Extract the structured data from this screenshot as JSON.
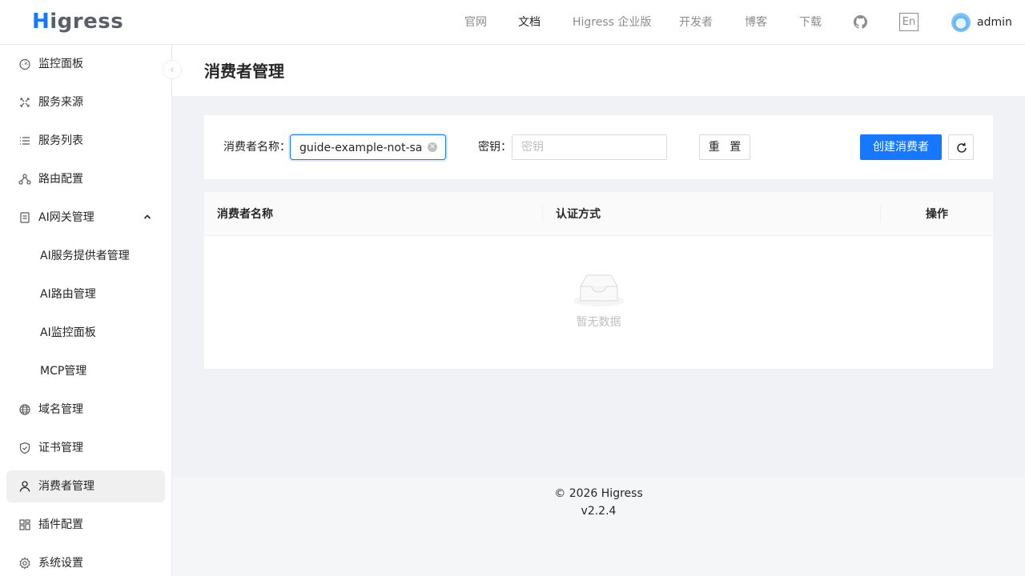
{
  "header": {
    "logo": "Higress",
    "nav": [
      "官网",
      "文档",
      "Higress 企业版",
      "开发者",
      "博客",
      "下载"
    ],
    "active_nav": "文档",
    "lang_button": "En",
    "github_icon": "github-icon",
    "username": "admin"
  },
  "sidebar": {
    "collapse_icon": "chevron-left-icon",
    "items": [
      {
        "label": "监控面板",
        "icon": "dashboard-icon"
      },
      {
        "label": "服务来源",
        "icon": "source-icon"
      },
      {
        "label": "服务列表",
        "icon": "list-icon"
      },
      {
        "label": "路由配置",
        "icon": "route-icon"
      },
      {
        "label": "AI网关管理",
        "icon": "ai-gateway-icon",
        "expanded": true
      },
      {
        "label": "AI服务提供者管理"
      },
      {
        "label": "AI路由管理"
      },
      {
        "label": "AI监控面板"
      },
      {
        "label": "MCP管理"
      },
      {
        "label": "域名管理",
        "icon": "globe-icon"
      },
      {
        "label": "证书管理",
        "icon": "shield-icon"
      },
      {
        "label": "消费者管理",
        "icon": "user-icon",
        "selected": true
      },
      {
        "label": "插件配置",
        "icon": "plugin-icon"
      },
      {
        "label": "系统设置",
        "icon": "gear-icon"
      }
    ]
  },
  "page": {
    "title": "消费者管理"
  },
  "filter": {
    "name_label": "消费者名称：",
    "name_value": "guide-example-not-saved",
    "key_label": "密钥：",
    "key_placeholder": "密钥",
    "reset_label": "重 置",
    "create_label": "创建消费者",
    "refresh_icon": "refresh-icon"
  },
  "table": {
    "columns": [
      "消费者名称",
      "认证方式",
      "操作"
    ],
    "rows": [],
    "empty_text": "暂无数据"
  },
  "footer": {
    "copyright": "© 2026 Higress",
    "version": "v2.2.4"
  },
  "colors": {
    "primary": "#1677ff",
    "selected_menu_bg": "#f0f0f0",
    "page_bg": "#f0f2f5"
  }
}
